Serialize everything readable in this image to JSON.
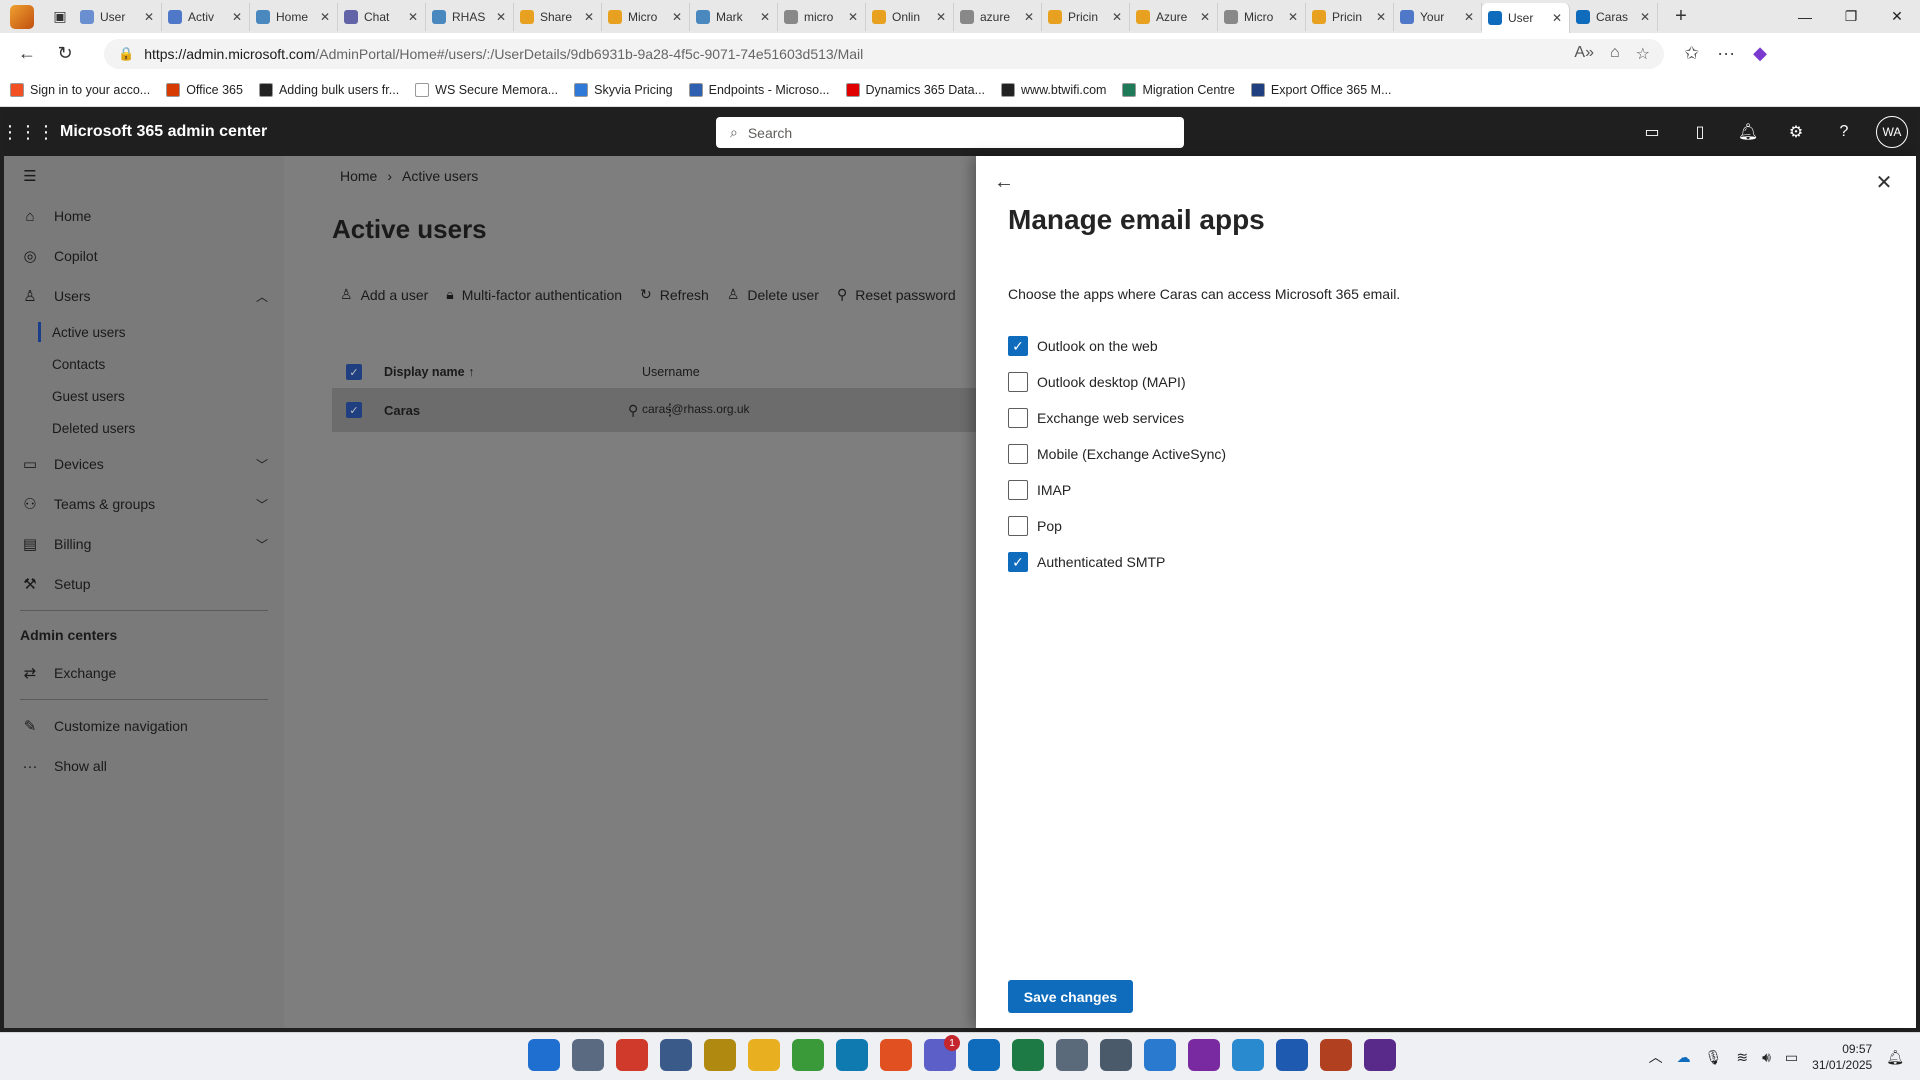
{
  "browser": {
    "tabs": [
      {
        "title": "User",
        "color": "#6a8fd0"
      },
      {
        "title": "Activ",
        "color": "#5078c8"
      },
      {
        "title": "Home",
        "color": "#4a88c0"
      },
      {
        "title": "Chat",
        "color": "#6264a7"
      },
      {
        "title": "RHAS",
        "color": "#4a88c0"
      },
      {
        "title": "Share",
        "color": "#e8a020"
      },
      {
        "title": "Micro",
        "color": "#e8a020"
      },
      {
        "title": "Mark",
        "color": "#4a88c0"
      },
      {
        "title": "micro",
        "color": "#888888"
      },
      {
        "title": "Onlin",
        "color": "#e8a020"
      },
      {
        "title": "azure",
        "color": "#888888"
      },
      {
        "title": "Pricin",
        "color": "#e8a020"
      },
      {
        "title": "Azure",
        "color": "#e8a020"
      },
      {
        "title": "Micro",
        "color": "#888888"
      },
      {
        "title": "Pricin",
        "color": "#e8a020"
      },
      {
        "title": "Your",
        "color": "#5078c8"
      },
      {
        "title": "User",
        "color": "#0f6cbd",
        "active": true
      },
      {
        "title": "Caras",
        "color": "#0f6cbd"
      }
    ],
    "url_host": "https://admin.microsoft.com",
    "url_path": "/AdminPortal/Home#/users/:/UserDetails/9db6931b-9a28-4f5c-9071-74e51603d513/Mail",
    "bookmarks": [
      {
        "label": "Sign in to your acco...",
        "color": "#f25022"
      },
      {
        "label": "Office 365",
        "color": "#d83b01"
      },
      {
        "label": "Adding bulk users fr...",
        "color": "#222222"
      },
      {
        "label": "WS Secure Memora...",
        "color": "#ffffff"
      },
      {
        "label": "Skyvia Pricing",
        "color": "#2f7ad8"
      },
      {
        "label": "Endpoints - Microso...",
        "color": "#2f5fb0"
      },
      {
        "label": "Dynamics 365 Data...",
        "color": "#e00000"
      },
      {
        "label": "www.btwifi.com",
        "color": "#222222"
      },
      {
        "label": "Migration Centre",
        "color": "#1f7a5a"
      },
      {
        "label": "Export Office 365 M...",
        "color": "#1f3f80"
      }
    ]
  },
  "header": {
    "app_title": "Microsoft 365 admin center",
    "search_placeholder": "Search",
    "avatar_initials": "WA"
  },
  "nav": {
    "items": [
      {
        "label": "Home",
        "icon": "home-icon"
      },
      {
        "label": "Copilot",
        "icon": "copilot-icon"
      },
      {
        "label": "Users",
        "icon": "user-icon"
      }
    ],
    "users_sub": [
      "Active users",
      "Contacts",
      "Guest users",
      "Deleted users"
    ],
    "more_items": [
      {
        "label": "Devices",
        "icon": "laptop-icon"
      },
      {
        "label": "Teams & groups",
        "icon": "people-icon"
      },
      {
        "label": "Billing",
        "icon": "card-icon"
      },
      {
        "label": "Setup",
        "icon": "wrench-icon"
      }
    ],
    "admin_centers_header": "Admin centers",
    "exchange": "Exchange",
    "customize": "Customize navigation",
    "show_all": "Show all"
  },
  "main": {
    "breadcrumb": [
      "Home",
      "Active users"
    ],
    "title": "Active users",
    "commands": [
      "Add a user",
      "Multi-factor authentication",
      "Refresh",
      "Delete user",
      "Reset password"
    ],
    "columns": {
      "display_name": "Display name",
      "username": "Username"
    },
    "rows": [
      {
        "display_name": "Caras",
        "username": "caras@rhass.org.uk"
      }
    ]
  },
  "panel": {
    "title": "Manage email apps",
    "description": "Choose the apps where Caras can access Microsoft 365 email.",
    "options": [
      {
        "label": "Outlook on the web",
        "checked": true
      },
      {
        "label": "Outlook desktop (MAPI)",
        "checked": false
      },
      {
        "label": "Exchange web services",
        "checked": false
      },
      {
        "label": "Mobile (Exchange ActiveSync)",
        "checked": false
      },
      {
        "label": "IMAP",
        "checked": false
      },
      {
        "label": "Pop",
        "checked": false
      },
      {
        "label": "Authenticated SMTP",
        "checked": true
      }
    ],
    "save_label": "Save changes"
  },
  "taskbar": {
    "apps": [
      {
        "name": "start",
        "color": "#1f6fd0"
      },
      {
        "name": "explorer-view",
        "color": "#5a6a80"
      },
      {
        "name": "chrome",
        "color": "#d03a2a"
      },
      {
        "name": "remote-desktop",
        "color": "#3a5a8a"
      },
      {
        "name": "dns",
        "color": "#b08a10"
      },
      {
        "name": "file-explorer",
        "color": "#e8b020"
      },
      {
        "name": "notepad",
        "color": "#3a9a3a"
      },
      {
        "name": "edge",
        "color": "#0f7ab0"
      },
      {
        "name": "brave",
        "color": "#e05020"
      },
      {
        "name": "teams",
        "color": "#5b5fc7",
        "badge": "1"
      },
      {
        "name": "outlook",
        "color": "#0f6cbd"
      },
      {
        "name": "excel",
        "color": "#1d7a45"
      },
      {
        "name": "settings",
        "color": "#5a6a7a"
      },
      {
        "name": "calculator",
        "color": "#4a5a6a"
      },
      {
        "name": "photos",
        "color": "#2a7ad0"
      },
      {
        "name": "onenote",
        "color": "#7a2aa0"
      },
      {
        "name": "azure-ds",
        "color": "#2a8ad0"
      },
      {
        "name": "word",
        "color": "#1e5ab0"
      },
      {
        "name": "app-stripes",
        "color": "#b04020"
      },
      {
        "name": "app-q",
        "color": "#5a2a8a"
      }
    ],
    "time": "09:57",
    "date": "31/01/2025"
  }
}
